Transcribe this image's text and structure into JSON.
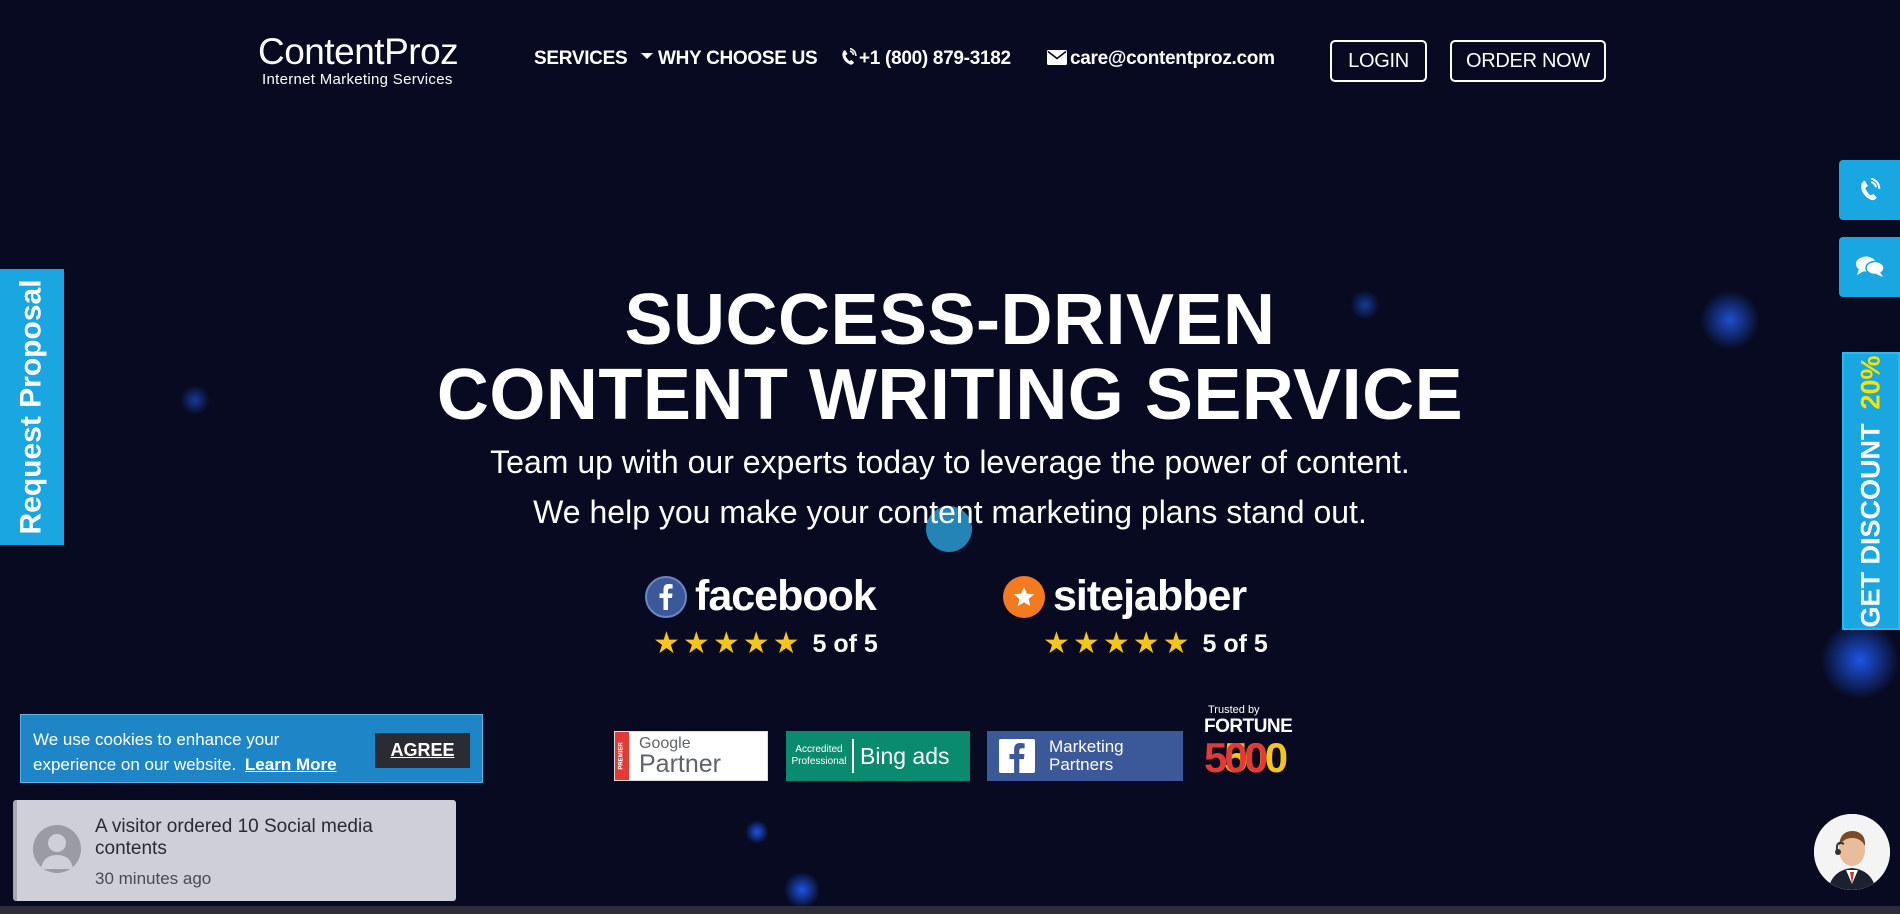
{
  "header": {
    "logo_main": "ContentProz",
    "logo_sub": "Internet Marketing Services",
    "nav": {
      "services": "SERVICES",
      "why_choose_us": "WHY CHOOSE US"
    },
    "phone": "+1 (800) 879-3182",
    "email": "care@contentproz.com",
    "login_label": "LOGIN",
    "order_now_label": "ORDER NOW"
  },
  "hero": {
    "title_line1": "SUCCESS-DRIVEN",
    "title_line2": "CONTENT WRITING SERVICE",
    "subtitle_line1": "Team up with our experts today to leverage the power of content.",
    "subtitle_line2": "We help you make your content marketing plans stand out."
  },
  "reviews": [
    {
      "brand": "facebook",
      "rating": "5 of 5",
      "stars": 5
    },
    {
      "brand": "sitejabber",
      "rating": "5 of 5",
      "stars": 5
    }
  ],
  "badges": {
    "google": {
      "premier": "PREMIER",
      "top": "Google",
      "bottom": "Partner"
    },
    "bing": {
      "left_top": "Accredited",
      "left_bottom": "Professional",
      "right": "Bing ads"
    },
    "facebook": {
      "top": "Marketing",
      "bottom": "Partners"
    },
    "fortune": {
      "top": "Trusted by",
      "middle": "FORTUNE",
      "bottom": "500"
    }
  },
  "side": {
    "request_proposal": "Request Proposal",
    "discount_label": "GET DISCOUNT",
    "discount_value": "20%"
  },
  "cookie": {
    "text": "We use cookies to enhance your experience on our website.",
    "link": "Learn More",
    "agree": "AGREE"
  },
  "visitor_notice": {
    "message": "A visitor ordered 10 Social media contents",
    "time": "30 minutes ago"
  },
  "colors": {
    "background": "#070a20",
    "accent": "#1aa6e0",
    "star": "#f5c518",
    "discount_text": "#f5e400"
  },
  "icons": [
    "phone-icon",
    "mail-icon",
    "chat-icon",
    "facebook-icon",
    "sitejabber-icon",
    "star-icon",
    "user-icon"
  ]
}
